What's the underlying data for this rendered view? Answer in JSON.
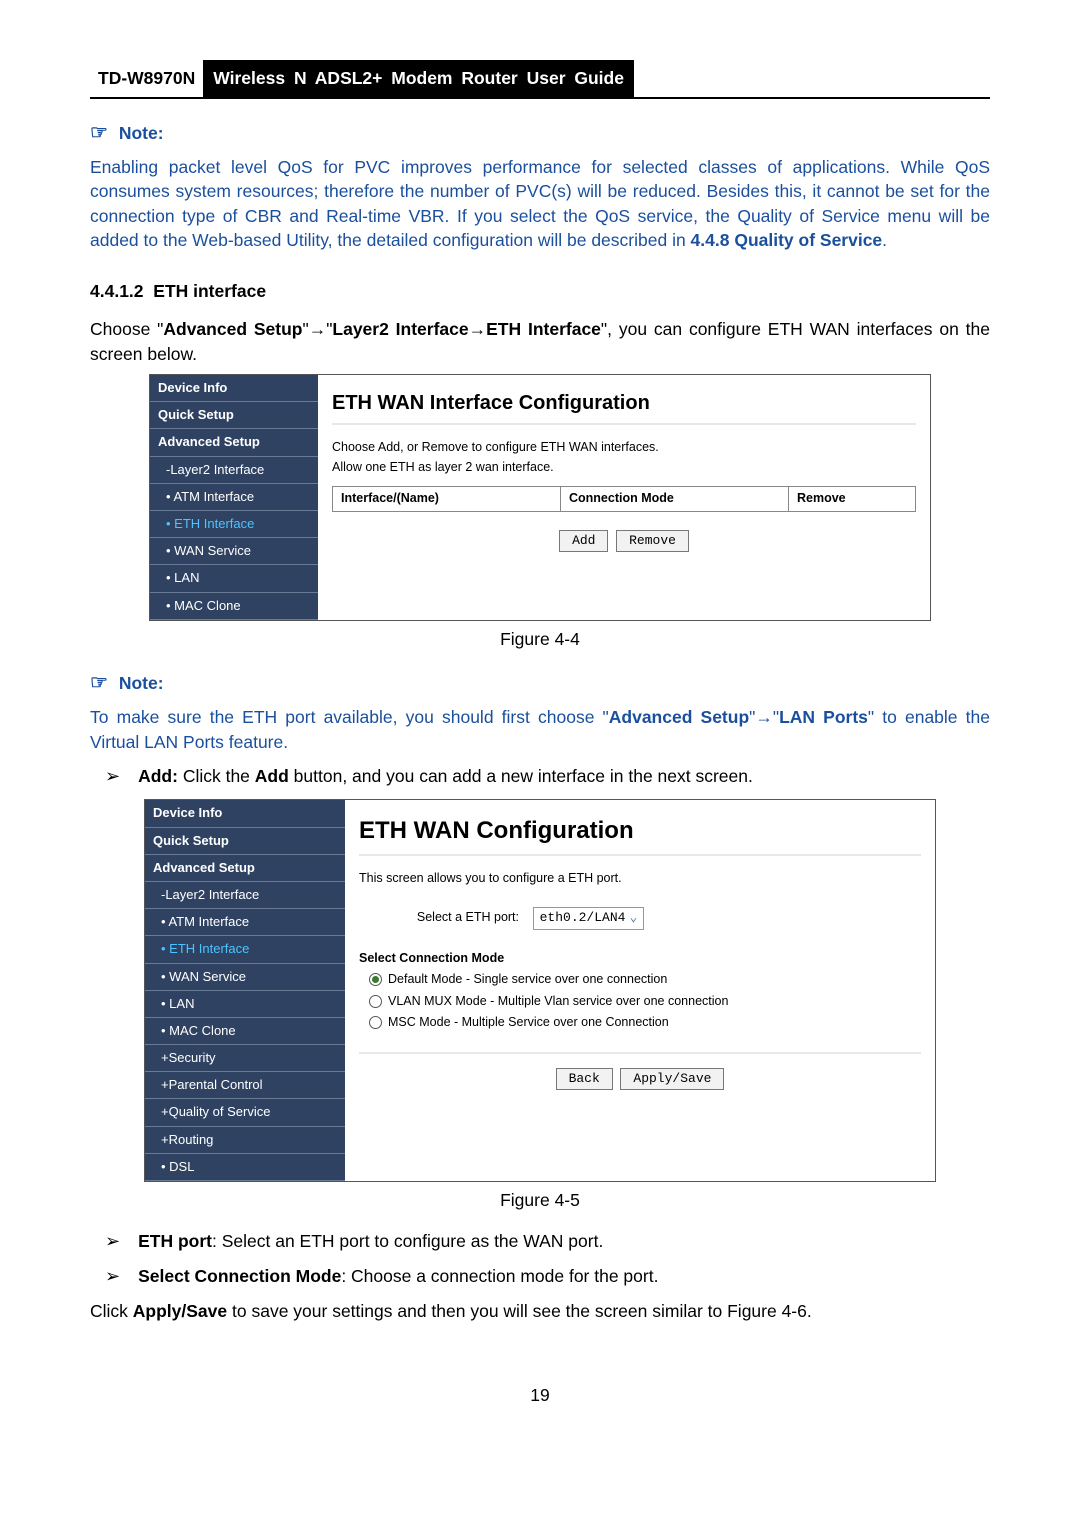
{
  "header": {
    "model": "TD-W8970N",
    "title": "Wireless N ADSL2+ Modem Router User Guide"
  },
  "note1": {
    "label": "Note:",
    "text": "Enabling packet level QoS for PVC improves performance for selected classes of applications. While QoS consumes system resources; therefore the number of PVC(s) will be reduced. Besides this, it cannot be set for the connection type of CBR and Real-time VBR. If you select the QoS service, the Quality of Service menu will be added to the Web-based Utility, the detailed configuration will be described in ",
    "bold": "4.4.8 Quality of Service",
    "tail": "."
  },
  "section": {
    "num": "4.4.1.2",
    "title": "ETH interface"
  },
  "intro": {
    "p1a": "Choose \"",
    "p1b": "Advanced Setup",
    "p1c": "\"",
    "p1d": "\"",
    "p1e": "Layer2 Interface",
    "p1f": "ETH Interface",
    "p1g": "\", you can configure ETH WAN interfaces on the screen below."
  },
  "fig4": {
    "nav": [
      "Device Info",
      "Quick Setup",
      "Advanced Setup",
      "-Layer2 Interface",
      "• ATM Interface",
      "• ETH Interface",
      "• WAN Service",
      "• LAN",
      "• MAC Clone"
    ],
    "title": "ETH WAN Interface Configuration",
    "line1": "Choose Add, or Remove to configure ETH WAN interfaces.",
    "line2": "Allow one ETH as layer 2 wan interface.",
    "cols": [
      "Interface/(Name)",
      "Connection Mode",
      "Remove"
    ],
    "btns": [
      "Add",
      "Remove"
    ],
    "caption": "Figure 4-4"
  },
  "note2": {
    "label": "Note:",
    "a": "To make sure the ETH port available, you should first choose \"",
    "b": "Advanced Setup",
    "c": "\"",
    "d": "\"",
    "e": "LAN Ports",
    "f": "\" to enable the Virtual LAN Ports feature."
  },
  "addline": {
    "lead": "Add:",
    "rest": " Click the ",
    "mid": "Add",
    "tail": " button, and you can add a new interface in the next screen."
  },
  "fig5": {
    "nav": [
      "Device Info",
      "Quick Setup",
      "Advanced Setup",
      "-Layer2 Interface",
      "• ATM Interface",
      "• ETH Interface",
      "• WAN Service",
      "• LAN",
      "• MAC Clone",
      "+Security",
      "+Parental Control",
      "+Quality of Service",
      "+Routing",
      "• DSL"
    ],
    "title": "ETH WAN Configuration",
    "desc": "This screen allows you to configure a ETH port.",
    "sel_label": "Select a ETH port:",
    "sel_value": "eth0.2/LAN4",
    "mode_header": "Select Connection Mode",
    "modes": [
      "Default Mode - Single service over one connection",
      "VLAN MUX Mode - Multiple Vlan service over one connection",
      "MSC Mode - Multiple Service over one Connection"
    ],
    "btns": [
      "Back",
      "Apply/Save"
    ],
    "caption": "Figure 4-5"
  },
  "bullets": [
    {
      "b": "ETH port",
      "t": ": Select an ETH port to configure as the WAN port."
    },
    {
      "b": "Select Connection Mode",
      "t": ": Choose a connection mode for the port."
    }
  ],
  "closing": {
    "a": "Click ",
    "b": "Apply/Save",
    "c": " to save your settings and then you will see the screen similar to Figure 4-6."
  },
  "pagenum": "19"
}
